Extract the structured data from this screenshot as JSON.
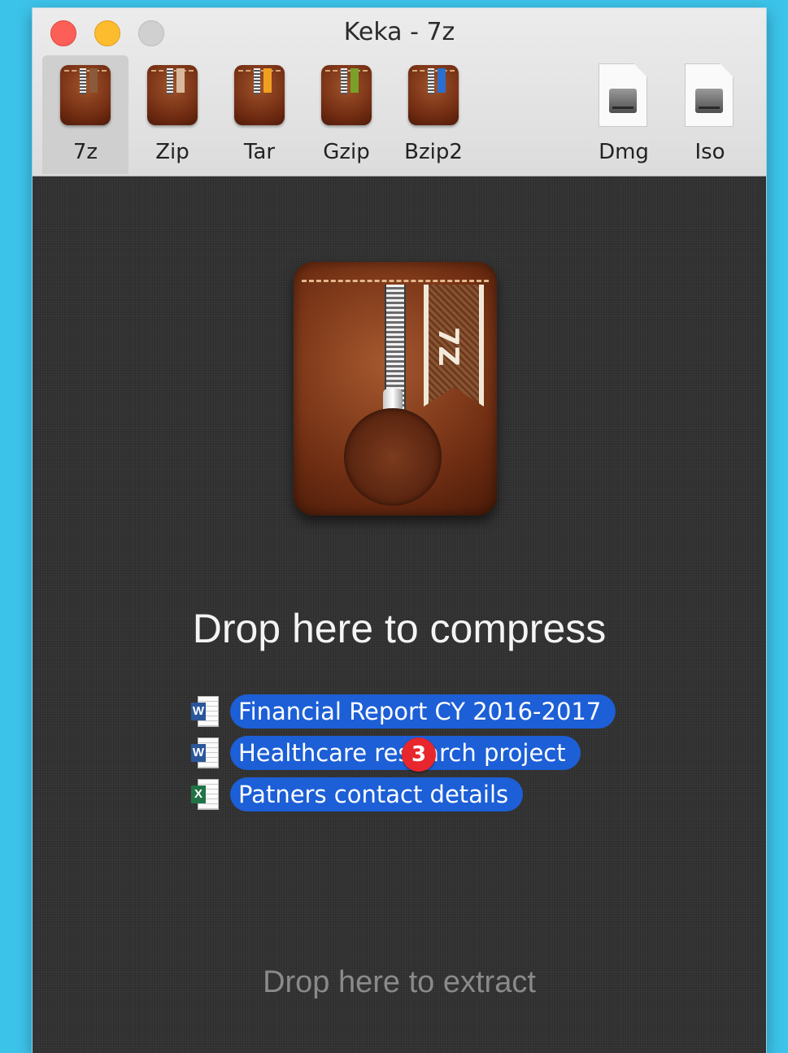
{
  "window": {
    "title": "Keka - 7z"
  },
  "toolbar": {
    "items": [
      {
        "label": "7z",
        "ribbon_color": "#8b5a3a"
      },
      {
        "label": "Zip",
        "ribbon_color": "#d9b99c"
      },
      {
        "label": "Tar",
        "ribbon_color": "#f0a020"
      },
      {
        "label": "Gzip",
        "ribbon_color": "#7aa02a"
      },
      {
        "label": "Bzip2",
        "ribbon_color": "#2a6fd0"
      },
      {
        "label": "Dmg",
        "icon": "disk-image-icon"
      },
      {
        "label": "Iso",
        "icon": "disk-image-icon"
      }
    ],
    "selected": "7z"
  },
  "main": {
    "ribbon_text": "7Z",
    "drop_compress_label": "Drop here to compress",
    "drop_extract_label": "Drop here to extract",
    "dragged_files": [
      {
        "name": "Financial Report CY 2016-2017",
        "type": "word",
        "badge": "W"
      },
      {
        "name": "Healthcare research project",
        "type": "word",
        "badge": "W"
      },
      {
        "name": "Patners contact details",
        "type": "excel",
        "badge": "X"
      }
    ],
    "drag_count": "3"
  },
  "colors": {
    "selection_blue": "#1c5fd6",
    "badge_red": "#e8262d",
    "word_blue": "#2b579a",
    "excel_green": "#217346"
  }
}
